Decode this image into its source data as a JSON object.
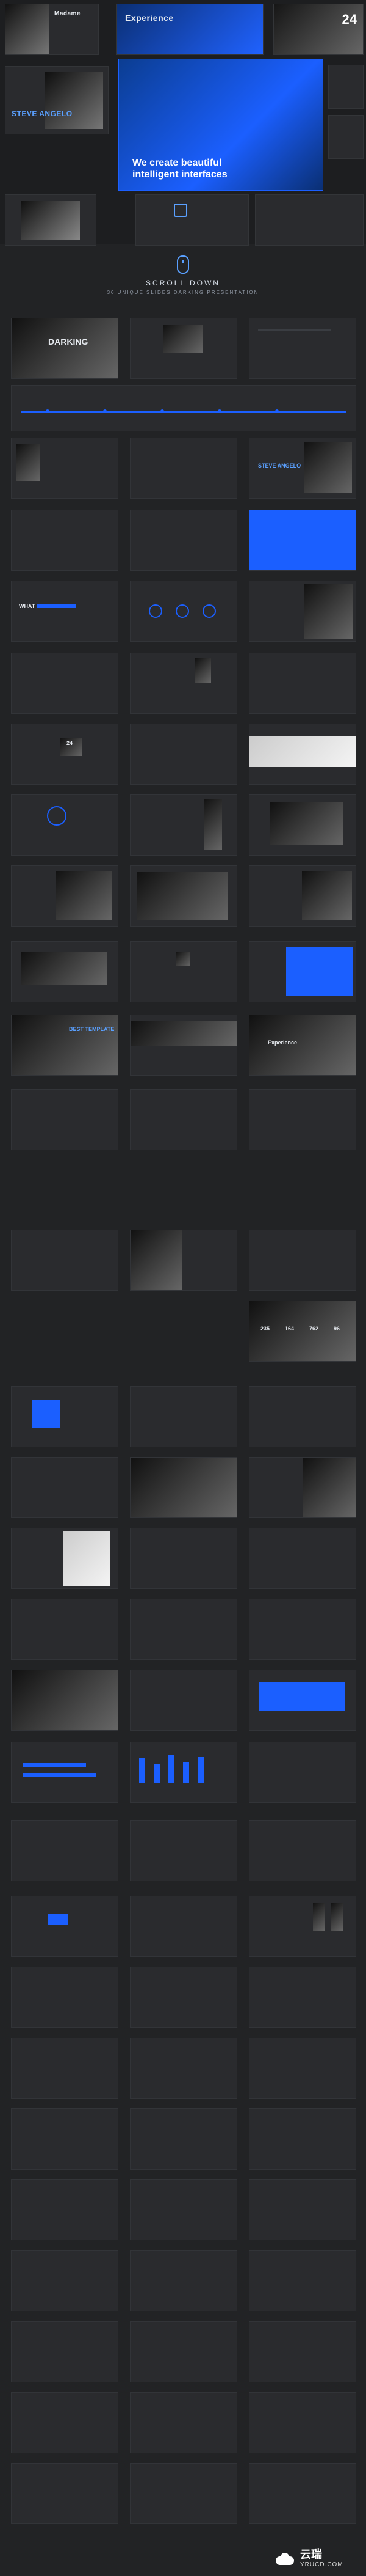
{
  "hero": {
    "number_tile": "24",
    "blue_slide_headline": "We create beautiful intelligent interfaces",
    "slide_tag_steve": "STEVE ANGELO",
    "slide_tag_experience": "Experience",
    "slide_tag_madame": "Madame",
    "slide_tag_darking": "DARKING"
  },
  "scroll": {
    "title": "SCROLL DOWN",
    "subtitle": "30 UNIQUE SLIDES DARKING PRESENTATION"
  },
  "gallery": {
    "labels": {
      "steve": "STEVE ANGELO",
      "what": "WHAT",
      "experience": "Experience",
      "best_template": "BEST TEMPLATE",
      "darking": "DARKING"
    },
    "numbers": {
      "n235": "235",
      "n164": "164",
      "n762": "762",
      "n96": "96",
      "n24": "24"
    }
  },
  "watermark": {
    "title": "云瑞",
    "subtitle": "YRUCD.COM"
  },
  "colors": {
    "accent": "#1b5fff",
    "background": "#222325",
    "slide": "#2a2b2e"
  }
}
